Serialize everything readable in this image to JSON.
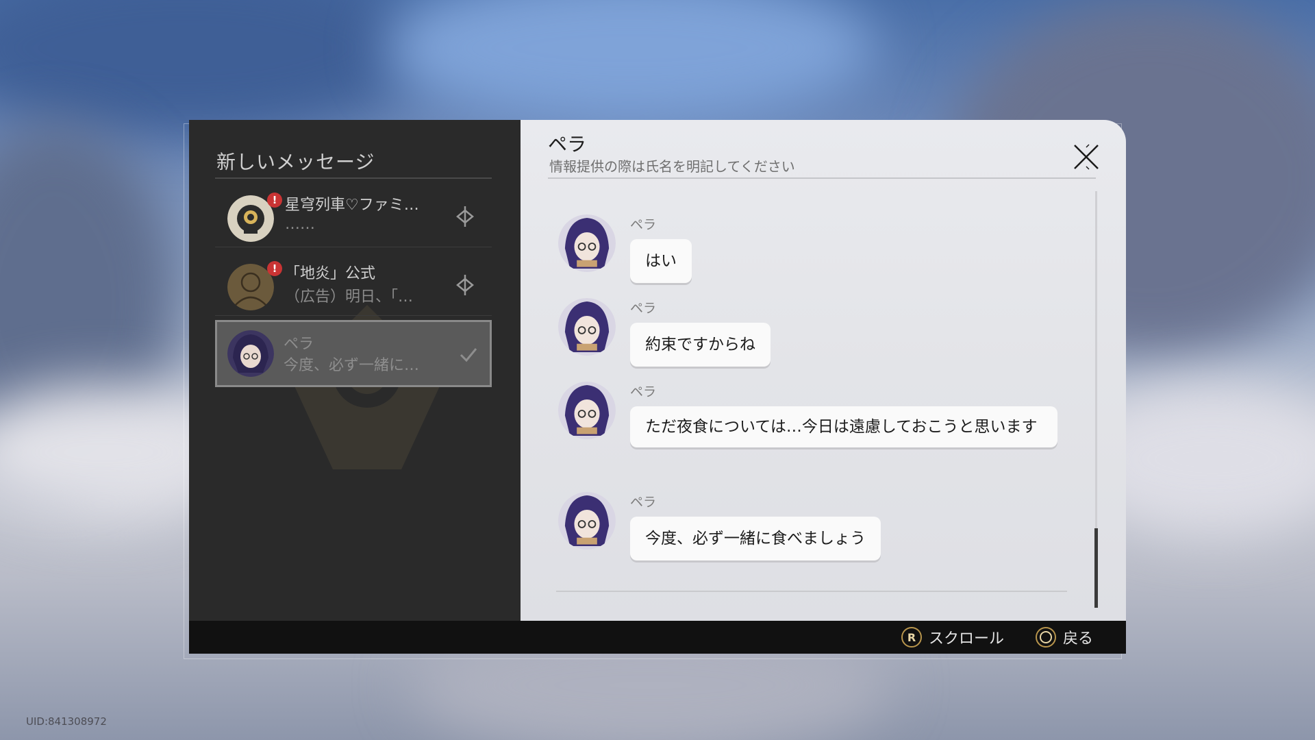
{
  "sidebar": {
    "title": "新しいメッセージ",
    "contacts": [
      {
        "name": "星穹列車♡ファミ…",
        "preview": "……",
        "badge": "!",
        "status_icon": "pending-icon"
      },
      {
        "name": "「地炎」公式",
        "preview": "（広告）明日、「…",
        "badge": "!",
        "status_icon": "pending-icon"
      },
      {
        "name": "ペラ",
        "preview": "今度、必ず一緒に…",
        "badge": "",
        "status_icon": "check-icon"
      }
    ]
  },
  "chat": {
    "title": "ペラ",
    "subtitle": "情報提供の際は氏名を明記してください",
    "messages": [
      {
        "sender": "ペラ",
        "text": "はい"
      },
      {
        "sender": "ペラ",
        "text": "約束ですからね"
      },
      {
        "sender": "ペラ",
        "text": "ただ夜食については…今日は遠慮しておこうと思います"
      },
      {
        "sender": "ペラ",
        "text": "今度、必ず一緒に食べましょう"
      }
    ]
  },
  "footer": {
    "scroll_button": "R",
    "scroll_label": "スクロール",
    "back_label": "戻る"
  },
  "uid": "UID:841308972",
  "colors": {
    "badge": "#c93434",
    "controller_accent": "#b8954c",
    "panel_dark": "#2a2a2a",
    "chat_bg": "#e6e7eb"
  }
}
